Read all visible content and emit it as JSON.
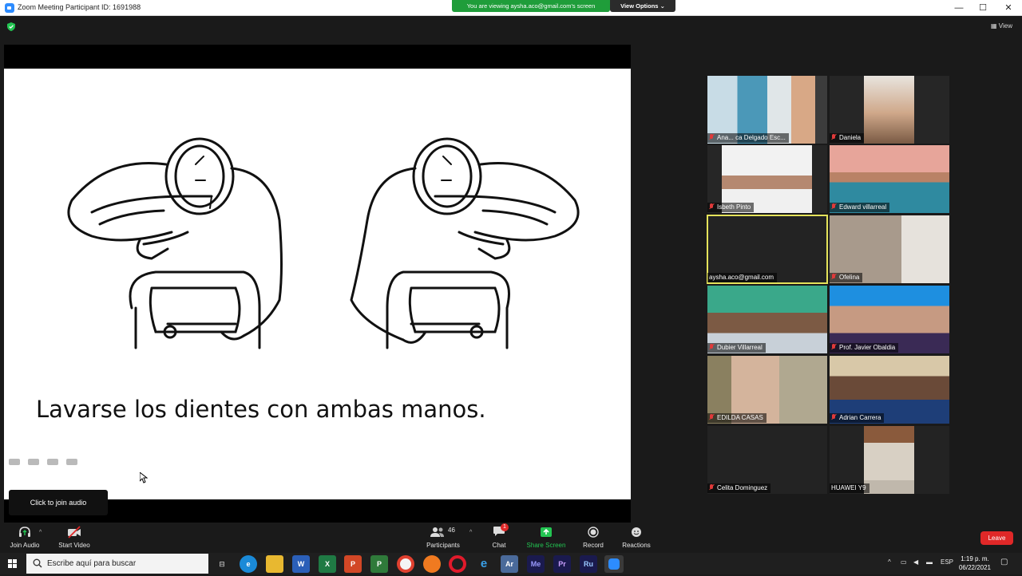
{
  "window": {
    "title": "Zoom Meeting Participant ID: 1691988",
    "share_banner": "You are viewing aysha.aco@gmail.com's screen",
    "view_options": "View Options",
    "minimize": "—",
    "maximize": "☐",
    "close": "✕"
  },
  "meeting": {
    "view_label": "View",
    "slide_caption": "Lavarse los dientes con ambas manos.",
    "join_tooltip": "Click to join audio"
  },
  "participants": [
    {
      "name": "Ana... ca Delgado Esc...",
      "muted": true
    },
    {
      "name": "Daniela",
      "muted": true
    },
    {
      "name": "Isbeth Pinto",
      "muted": true
    },
    {
      "name": "Edward villarreal",
      "muted": true
    },
    {
      "name": "aysha.aco@gmail.com",
      "muted": false,
      "active": true
    },
    {
      "name": "Ofelina",
      "muted": true
    },
    {
      "name": "Dubier Villarreal",
      "muted": true
    },
    {
      "name": "Prof. Javier Obaldia",
      "muted": true
    },
    {
      "name": "EDILDA CASAS",
      "muted": true
    },
    {
      "name": "Adrian Carrera",
      "muted": true
    },
    {
      "name": "Celita Dominguez",
      "muted": true
    },
    {
      "name": "HUAWEI Y9",
      "muted": false
    }
  ],
  "toolbar": {
    "join_audio": "Join Audio",
    "start_video": "Start Video",
    "participants": "Participants",
    "participants_count": "46",
    "chat": "Chat",
    "chat_badge": "1",
    "share_screen": "Share Screen",
    "record": "Record",
    "reactions": "Reactions",
    "leave": "Leave"
  },
  "taskbar": {
    "search_placeholder": "Escribe aquí para buscar",
    "language": "ESP",
    "time": "1:19 p. m.",
    "date": "06/22/2021",
    "apps": [
      "task-view",
      "edge",
      "file-explorer",
      "word",
      "excel",
      "powerpoint",
      "project",
      "chrome",
      "firefox",
      "opera",
      "internet-explorer",
      "adobe-acrobat",
      "media-encoder",
      "premiere",
      "russian-app",
      "zoom"
    ]
  },
  "colors": {
    "share_banner": "#1f9d3a",
    "active_speaker_border": "#e5e35a",
    "leave": "#e02828",
    "share_screen_icon": "#23c552"
  }
}
